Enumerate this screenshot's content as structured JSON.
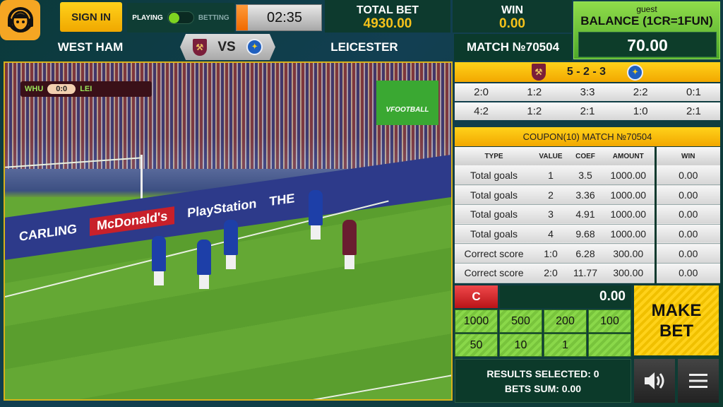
{
  "header": {
    "sign_in": "SIGN IN",
    "mode_playing": "PLAYING",
    "mode_betting": "BETTING",
    "timer": "02:35",
    "timer_progress": 0.13,
    "total_bet_label": "TOTAL BET",
    "total_bet": "4930.00",
    "win_label": "WIN",
    "win": "0.00",
    "user": "guest",
    "balance_label": "BALANCE (1CR=1FUN)",
    "balance": "70.00"
  },
  "match": {
    "home": "WEST HAM",
    "vs": "VS",
    "away": "LEICESTER",
    "number": "MATCH №70504"
  },
  "video": {
    "home_abbr": "WHU",
    "away_abbr": "LEI",
    "score": "0:0",
    "logo": "VFOOTBALL",
    "ads": [
      "CARLING",
      "McDonald's",
      "PlayStation",
      "THE"
    ]
  },
  "stats": {
    "summary": "5 - 2 - 3",
    "recent": [
      [
        "2:0",
        "1:2",
        "3:3",
        "2:2",
        "0:1"
      ],
      [
        "4:2",
        "1:2",
        "2:1",
        "1:0",
        "2:1"
      ]
    ]
  },
  "coupon": {
    "title": "COUPON(10) MATCH №70504",
    "columns": [
      "TYPE",
      "VALUE",
      "COEF",
      "AMOUNT",
      "WIN"
    ],
    "rows": [
      [
        "Total goals",
        "1",
        "3.5",
        "1000.00",
        "0.00"
      ],
      [
        "Total goals",
        "2",
        "3.36",
        "1000.00",
        "0.00"
      ],
      [
        "Total goals",
        "3",
        "4.91",
        "1000.00",
        "0.00"
      ],
      [
        "Total goals",
        "4",
        "9.68",
        "1000.00",
        "0.00"
      ],
      [
        "Correct score",
        "1:0",
        "6.28",
        "300.00",
        "0.00"
      ],
      [
        "Correct score",
        "2:0",
        "11.77",
        "300.00",
        "0.00"
      ]
    ]
  },
  "betting": {
    "clear": "C",
    "amount": "0.00",
    "chips": [
      "1000",
      "500",
      "200",
      "100",
      "50",
      "10",
      "1",
      ""
    ],
    "make_bet_1": "MAKE",
    "make_bet_2": "BET",
    "results_selected": "RESULTS SELECTED: 0",
    "bets_sum": "BETS SUM: 0.00"
  },
  "colors": {
    "accent_yellow": "#f6c21a",
    "panel_green": "#0c3a2a",
    "chip_green": "#8ad84a",
    "clear_red": "#e0282c"
  }
}
